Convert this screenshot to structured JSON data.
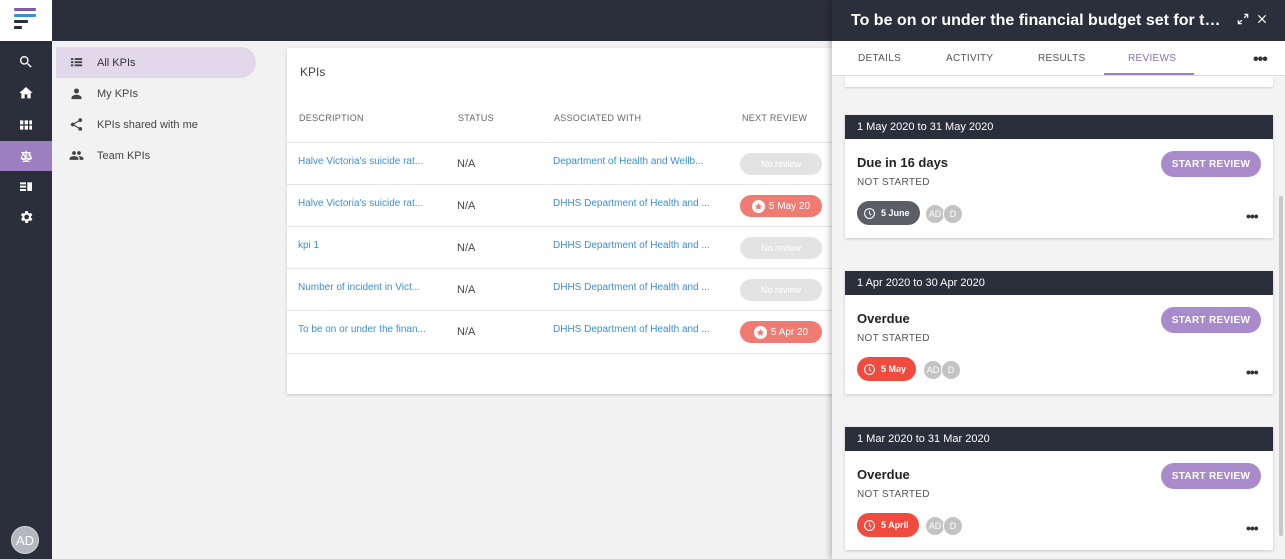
{
  "colors": {
    "dark": "#2b2e3b",
    "accent": "#9b7fc0",
    "link": "#3a8fd4",
    "danger": "#f04b3f",
    "due": "#f07b73"
  },
  "rail": {
    "items": [
      "search-icon",
      "home-icon",
      "grid-icon",
      "scales-icon",
      "list-icon",
      "gear-icon"
    ],
    "avatar": "AD"
  },
  "nav": {
    "items": [
      {
        "label": "All KPIs",
        "icon": "table-list-icon"
      },
      {
        "label": "My KPIs",
        "icon": "person-icon"
      },
      {
        "label": "KPIs shared with me",
        "icon": "share-icon"
      },
      {
        "label": "Team KPIs",
        "icon": "group-icon"
      }
    ]
  },
  "kpis": {
    "title": "KPIs",
    "columns": [
      "DESCRIPTION",
      "STATUS",
      "ASSOCIATED WITH",
      "NEXT REVIEW"
    ],
    "rows": [
      {
        "description": "Halve Victoria's suicide rat...",
        "status": "N/A",
        "associated": "Department of Health and Wellb...",
        "review": "No review",
        "due": false
      },
      {
        "description": "Halve Victoria's suicide rat...",
        "status": "N/A",
        "associated": "DHHS Department of Health and ...",
        "review": "5 May 20",
        "due": true
      },
      {
        "description": "kpi 1",
        "status": "N/A",
        "associated": "DHHS Department of Health and ...",
        "review": "No review",
        "due": false
      },
      {
        "description": "Number of incident in Vict...",
        "status": "N/A",
        "associated": "DHHS Department of Health and ...",
        "review": "No review",
        "due": false
      },
      {
        "description": "To be on or under the finan...",
        "status": "N/A",
        "associated": "DHHS Department of Health and ...",
        "review": "5 Apr 20",
        "due": true
      }
    ]
  },
  "panel": {
    "title": "To be on or under the financial budget set for th...",
    "tabs": [
      "DETAILS",
      "ACTIVITY",
      "RESULTS",
      "REVIEWS"
    ],
    "active_tab": "REVIEWS",
    "reviews": [
      {
        "period": "1 May 2020 to 31 May 2020",
        "status": "Due in 16 days",
        "state": "NOT STARTED",
        "button": "START REVIEW",
        "date": "5 June",
        "overdue": false,
        "avatars": [
          "AD",
          "D"
        ]
      },
      {
        "period": "1 Apr 2020 to 30 Apr 2020",
        "status": "Overdue",
        "state": "NOT STARTED",
        "button": "START REVIEW",
        "date": "5 May",
        "overdue": true,
        "avatars": [
          "AD",
          "D"
        ]
      },
      {
        "period": "1 Mar 2020 to 31 Mar 2020",
        "status": "Overdue",
        "state": "NOT STARTED",
        "button": "START REVIEW",
        "date": "5 April",
        "overdue": true,
        "avatars": [
          "AD",
          "D"
        ]
      }
    ]
  }
}
